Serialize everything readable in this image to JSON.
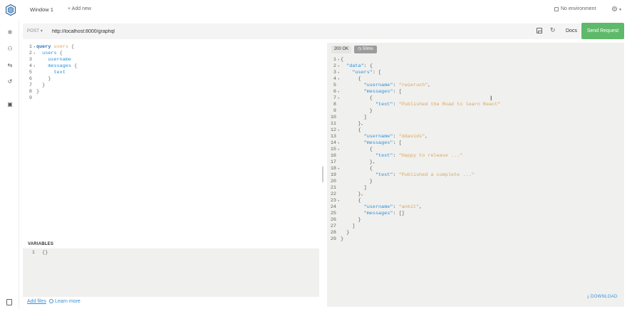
{
  "header": {
    "window_tab": "Window 1",
    "add_new": "+ Add new",
    "environment": "No environment"
  },
  "request": {
    "method": "POST ▾",
    "url": "http://localhost:8000/graphql",
    "docs_label": "Docs",
    "send_label": "Send Request"
  },
  "query_lines": [
    {
      "n": "1",
      "fold": "▾"
    },
    {
      "n": "2",
      "fold": "▾"
    },
    {
      "n": "3",
      "fold": ""
    },
    {
      "n": "4",
      "fold": "▾"
    },
    {
      "n": "5",
      "fold": ""
    },
    {
      "n": "6",
      "fold": ""
    },
    {
      "n": "7",
      "fold": ""
    },
    {
      "n": "8",
      "fold": ""
    },
    {
      "n": "9",
      "fold": ""
    }
  ],
  "query": {
    "keyword": "query",
    "op_name": "users",
    "field_users": "users",
    "field_username": "username",
    "field_messages": "messages",
    "field_text": "text",
    "brace_open": "{",
    "brace_close": "}"
  },
  "variables": {
    "title": "VARIABLES",
    "line_no": "1",
    "value": "{}",
    "add_files": "Add files",
    "learn_more": "Learn more"
  },
  "response": {
    "status": "200 OK",
    "time": "50ms",
    "download": "DOWNLOAD",
    "lines": [
      {
        "n": "1",
        "f": "▾",
        "t": [
          {
            "c": "rpn",
            "v": "{"
          }
        ]
      },
      {
        "n": "2",
        "f": "▾",
        "t": [
          {
            "c": "rpn",
            "v": "  "
          },
          {
            "c": "key",
            "v": "\"data\""
          },
          {
            "c": "rpn",
            "v": ": {"
          }
        ]
      },
      {
        "n": "3",
        "f": "▾",
        "t": [
          {
            "c": "rpn",
            "v": "    "
          },
          {
            "c": "key",
            "v": "\"users\""
          },
          {
            "c": "rpn",
            "v": ": ["
          }
        ]
      },
      {
        "n": "4",
        "f": "▾",
        "t": [
          {
            "c": "rpn",
            "v": "      {"
          }
        ]
      },
      {
        "n": "5",
        "f": "",
        "t": [
          {
            "c": "rpn",
            "v": "        "
          },
          {
            "c": "key",
            "v": "\"username\""
          },
          {
            "c": "rpn",
            "v": ": "
          },
          {
            "c": "str",
            "v": "\"rwieruch\""
          },
          {
            "c": "rpn",
            "v": ","
          }
        ]
      },
      {
        "n": "6",
        "f": "▾",
        "t": [
          {
            "c": "rpn",
            "v": "        "
          },
          {
            "c": "key",
            "v": "\"messages\""
          },
          {
            "c": "rpn",
            "v": ": ["
          }
        ]
      },
      {
        "n": "7",
        "f": "▾",
        "t": [
          {
            "c": "rpn",
            "v": "          {"
          }
        ]
      },
      {
        "n": "8",
        "f": "",
        "t": [
          {
            "c": "rpn",
            "v": "            "
          },
          {
            "c": "key",
            "v": "\"text\""
          },
          {
            "c": "rpn",
            "v": ": "
          },
          {
            "c": "str",
            "v": "\"Published the Road to learn React\""
          }
        ]
      },
      {
        "n": "9",
        "f": "",
        "t": [
          {
            "c": "rpn",
            "v": "          }"
          }
        ]
      },
      {
        "n": "10",
        "f": "",
        "t": [
          {
            "c": "rpn",
            "v": "        ]"
          }
        ]
      },
      {
        "n": "11",
        "f": "",
        "t": [
          {
            "c": "rpn",
            "v": "      },"
          }
        ]
      },
      {
        "n": "12",
        "f": "▾",
        "t": [
          {
            "c": "rpn",
            "v": "      {"
          }
        ]
      },
      {
        "n": "13",
        "f": "",
        "t": [
          {
            "c": "rpn",
            "v": "        "
          },
          {
            "c": "key",
            "v": "\"username\""
          },
          {
            "c": "rpn",
            "v": ": "
          },
          {
            "c": "str",
            "v": "\"ddavids\""
          },
          {
            "c": "rpn",
            "v": ","
          }
        ]
      },
      {
        "n": "14",
        "f": "▾",
        "t": [
          {
            "c": "rpn",
            "v": "        "
          },
          {
            "c": "key",
            "v": "\"messages\""
          },
          {
            "c": "rpn",
            "v": ": ["
          }
        ]
      },
      {
        "n": "15",
        "f": "▾",
        "t": [
          {
            "c": "rpn",
            "v": "          {"
          }
        ]
      },
      {
        "n": "16",
        "f": "",
        "t": [
          {
            "c": "rpn",
            "v": "            "
          },
          {
            "c": "key",
            "v": "\"text\""
          },
          {
            "c": "rpn",
            "v": ": "
          },
          {
            "c": "str",
            "v": "\"Happy to release ...\""
          }
        ]
      },
      {
        "n": "17",
        "f": "",
        "t": [
          {
            "c": "rpn",
            "v": "          },"
          }
        ]
      },
      {
        "n": "18",
        "f": "▾",
        "t": [
          {
            "c": "rpn",
            "v": "          {"
          }
        ]
      },
      {
        "n": "19",
        "f": "",
        "t": [
          {
            "c": "rpn",
            "v": "            "
          },
          {
            "c": "key",
            "v": "\"text\""
          },
          {
            "c": "rpn",
            "v": ": "
          },
          {
            "c": "str",
            "v": "\"Published a complete ...\""
          }
        ]
      },
      {
        "n": "20",
        "f": "",
        "t": [
          {
            "c": "rpn",
            "v": "          }"
          }
        ]
      },
      {
        "n": "21",
        "f": "",
        "t": [
          {
            "c": "rpn",
            "v": "        ]"
          }
        ]
      },
      {
        "n": "22",
        "f": "",
        "t": [
          {
            "c": "rpn",
            "v": "      },"
          }
        ]
      },
      {
        "n": "23",
        "f": "▾",
        "t": [
          {
            "c": "rpn",
            "v": "      {"
          }
        ]
      },
      {
        "n": "24",
        "f": "",
        "t": [
          {
            "c": "rpn",
            "v": "        "
          },
          {
            "c": "key",
            "v": "\"username\""
          },
          {
            "c": "rpn",
            "v": ": "
          },
          {
            "c": "str",
            "v": "\"ankit\""
          },
          {
            "c": "rpn",
            "v": ","
          }
        ]
      },
      {
        "n": "25",
        "f": "",
        "t": [
          {
            "c": "rpn",
            "v": "        "
          },
          {
            "c": "key",
            "v": "\"messages\""
          },
          {
            "c": "rpn",
            "v": ": []"
          }
        ]
      },
      {
        "n": "26",
        "f": "",
        "t": [
          {
            "c": "rpn",
            "v": "      }"
          }
        ]
      },
      {
        "n": "27",
        "f": "",
        "t": [
          {
            "c": "rpn",
            "v": "    ]"
          }
        ]
      },
      {
        "n": "28",
        "f": "",
        "t": [
          {
            "c": "rpn",
            "v": "  }"
          }
        ]
      },
      {
        "n": "29",
        "f": "",
        "t": [
          {
            "c": "rpn",
            "v": "}"
          }
        ]
      }
    ]
  },
  "colors": {
    "accent": "#5fb96a",
    "link": "#3c8fd6",
    "keyword": "#2b6fb8",
    "string": "#d9a65e"
  },
  "icons": {
    "logo": "altair-logo-icon",
    "settings": "gear-icon",
    "sidebar": [
      "gear-icon",
      "users-icon",
      "swap-icon",
      "history-icon",
      "collection-icon"
    ],
    "save": "save-icon",
    "refresh": "refresh-icon",
    "time": "clock-icon",
    "download": "download-icon",
    "cursor": "text-cursor-icon"
  }
}
